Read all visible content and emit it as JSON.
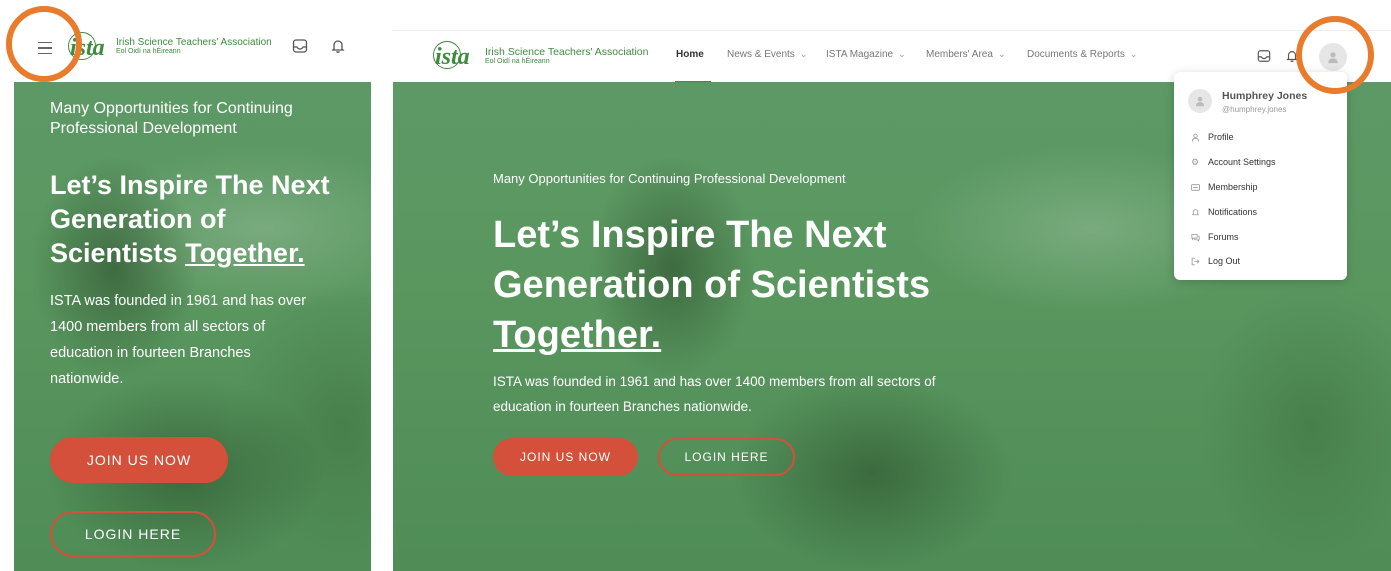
{
  "brand": {
    "logo_mark": "ista",
    "name": "Irish Science Teachers' Association",
    "subtitle": "Eol Oidí na hÉireann"
  },
  "hero": {
    "tagline": "Many Opportunities for Continuing Professional Development",
    "heading_main": "Let’s Inspire The Next Generation of Scientists",
    "heading_emphasis": "Together.",
    "body": "ISTA was founded in 1961 and has over 1400 members from all sectors of education in fourteen Branches nationwide.",
    "join_label": "JOIN US NOW",
    "login_label": "LOGIN HERE"
  },
  "nav": {
    "items": [
      {
        "label": "Home",
        "has_dropdown": false,
        "active": true
      },
      {
        "label": "News & Events",
        "has_dropdown": true
      },
      {
        "label": "ISTA Magazine",
        "has_dropdown": true
      },
      {
        "label": "Members' Area",
        "has_dropdown": true
      },
      {
        "label": "Documents & Reports",
        "has_dropdown": true
      }
    ]
  },
  "icons": {
    "menu": "hamburger-menu-icon",
    "inbox": "inbox-icon",
    "notifications": "bell-icon",
    "avatar": "user-avatar-icon"
  },
  "user_menu": {
    "name": "Humphrey Jones",
    "handle": "@humphrey.jones",
    "items": [
      {
        "label": "Profile",
        "icon": "user-icon"
      },
      {
        "label": "Account Settings",
        "icon": "gear-icon"
      },
      {
        "label": "Membership",
        "icon": "card-icon"
      },
      {
        "label": "Notifications",
        "icon": "bell-icon"
      },
      {
        "label": "Forums",
        "icon": "chat-icon"
      },
      {
        "label": "Log Out",
        "icon": "logout-icon"
      }
    ]
  },
  "colors": {
    "brand_green": "#3f8b3f",
    "hero_overlay_green": "#5a975f",
    "accent_red": "#d4503a",
    "highlight_orange": "#e97c2c"
  }
}
